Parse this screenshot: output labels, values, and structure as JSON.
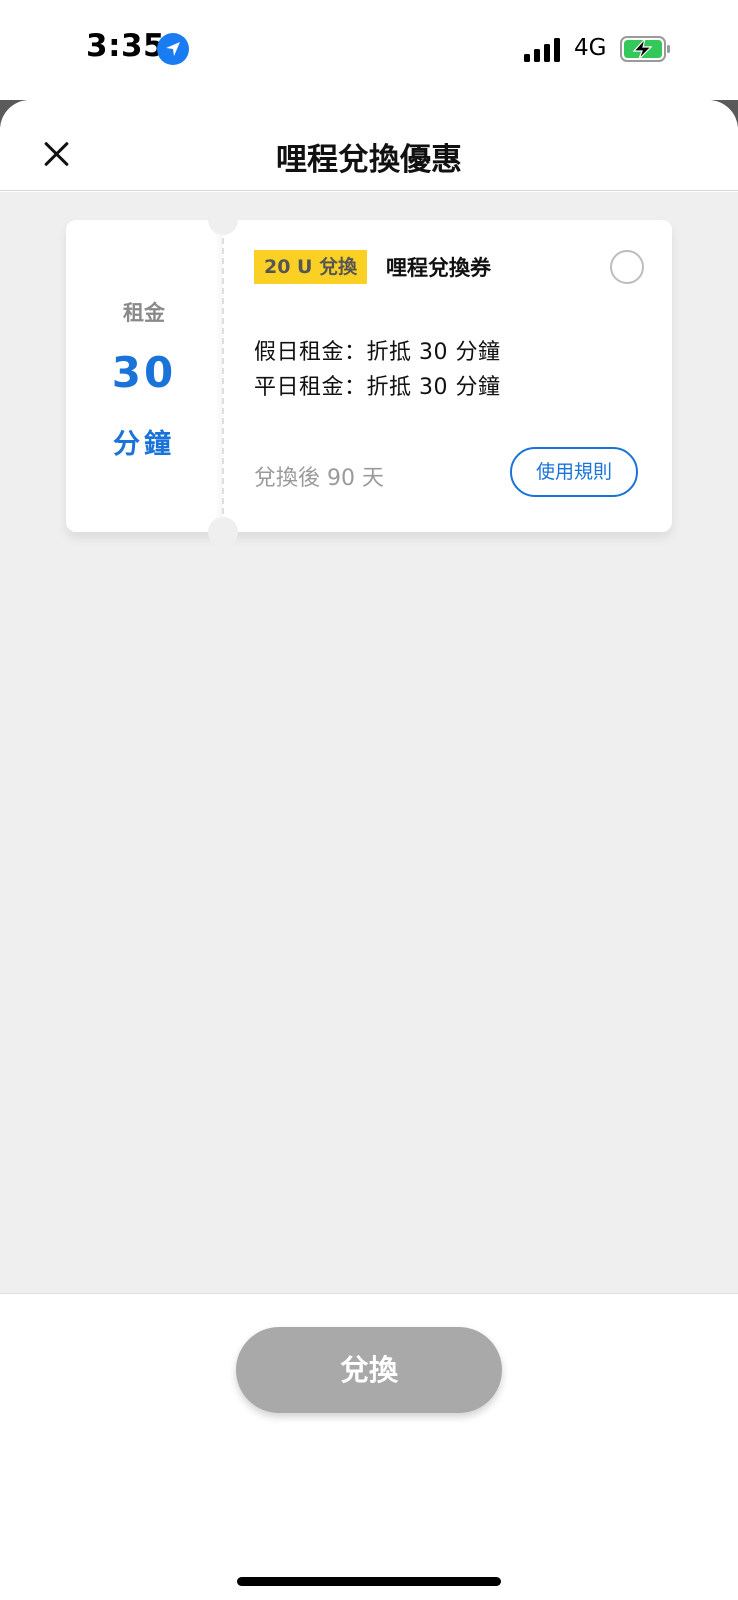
{
  "status_bar": {
    "time": "3:35",
    "network": "4G",
    "icons": [
      "location-arrow-icon",
      "signal-icon",
      "battery-charging-icon"
    ]
  },
  "header": {
    "title": "哩程兌換優惠",
    "close_icon": "close-icon"
  },
  "coupon": {
    "left": {
      "label": "租金",
      "value": "30",
      "unit": "分鐘"
    },
    "badge": "20 U 兌換",
    "name": "哩程兌換券",
    "details": [
      "假日租金：折抵 30 分鐘",
      "平日租金：折抵 30 分鐘"
    ],
    "expiry": "兌換後 90 天",
    "rules_label": "使用規則",
    "selected": false
  },
  "footer": {
    "redeem_label": "兌換"
  },
  "colors": {
    "accent": "#1a73d9",
    "badge": "#fbd024",
    "disabled_button": "#a9a9a9",
    "background": "#efefef"
  }
}
